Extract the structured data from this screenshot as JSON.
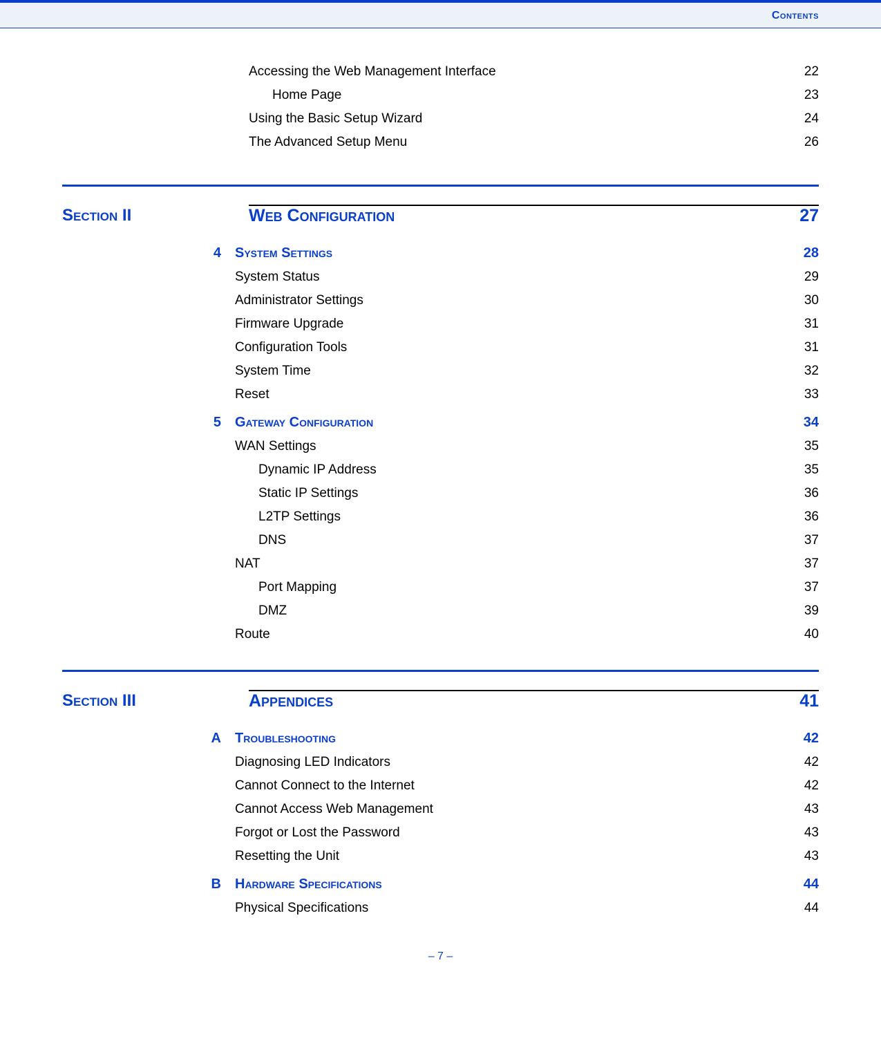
{
  "header": {
    "label": "Contents"
  },
  "pre_items": [
    {
      "title": "Accessing the Web Management Interface",
      "page": "22",
      "indent": 0
    },
    {
      "title": "Home Page",
      "page": "23",
      "indent": 1
    },
    {
      "title": "Using the Basic Setup Wizard",
      "page": "24",
      "indent": 0
    },
    {
      "title": "The Advanced Setup Menu",
      "page": "26",
      "indent": 0
    }
  ],
  "sections": [
    {
      "label": "Section II",
      "title": "Web Configuration",
      "page": "27",
      "chapters": [
        {
          "num": "4",
          "title": "System Settings",
          "page": "28",
          "items": [
            {
              "title": "System Status",
              "page": "29",
              "indent": 0
            },
            {
              "title": "Administrator Settings",
              "page": "30",
              "indent": 0
            },
            {
              "title": "Firmware Upgrade",
              "page": "31",
              "indent": 0
            },
            {
              "title": "Configuration Tools",
              "page": "31",
              "indent": 0
            },
            {
              "title": "System Time",
              "page": "32",
              "indent": 0
            },
            {
              "title": "Reset",
              "page": "33",
              "indent": 0
            }
          ]
        },
        {
          "num": "5",
          "title": "Gateway Configuration",
          "page": "34",
          "items": [
            {
              "title": "WAN Settings",
              "page": "35",
              "indent": 0
            },
            {
              "title": "Dynamic IP Address",
              "page": "35",
              "indent": 1
            },
            {
              "title": "Static IP Settings",
              "page": "36",
              "indent": 1
            },
            {
              "title": "L2TP Settings",
              "page": "36",
              "indent": 1
            },
            {
              "title": "DNS",
              "page": "37",
              "indent": 1
            },
            {
              "title": "NAT",
              "page": "37",
              "indent": 0
            },
            {
              "title": "Port Mapping",
              "page": "37",
              "indent": 1
            },
            {
              "title": "DMZ",
              "page": "39",
              "indent": 1
            },
            {
              "title": "Route",
              "page": "40",
              "indent": 0
            }
          ]
        }
      ]
    },
    {
      "label": "Section III",
      "title": "Appendices",
      "page": "41",
      "chapters": [
        {
          "num": "A",
          "title": "Troubleshooting",
          "page": "42",
          "items": [
            {
              "title": "Diagnosing LED Indicators",
              "page": "42",
              "indent": 0
            },
            {
              "title": "Cannot Connect to the Internet",
              "page": "42",
              "indent": 0
            },
            {
              "title": "Cannot Access Web Management",
              "page": "43",
              "indent": 0
            },
            {
              "title": "Forgot or Lost the Password",
              "page": "43",
              "indent": 0
            },
            {
              "title": "Resetting the Unit",
              "page": "43",
              "indent": 0
            }
          ]
        },
        {
          "num": "B",
          "title": "Hardware Specifications",
          "page": "44",
          "items": [
            {
              "title": "Physical Specifications",
              "page": "44",
              "indent": 0
            }
          ]
        }
      ]
    }
  ],
  "footer": "–  7  –"
}
